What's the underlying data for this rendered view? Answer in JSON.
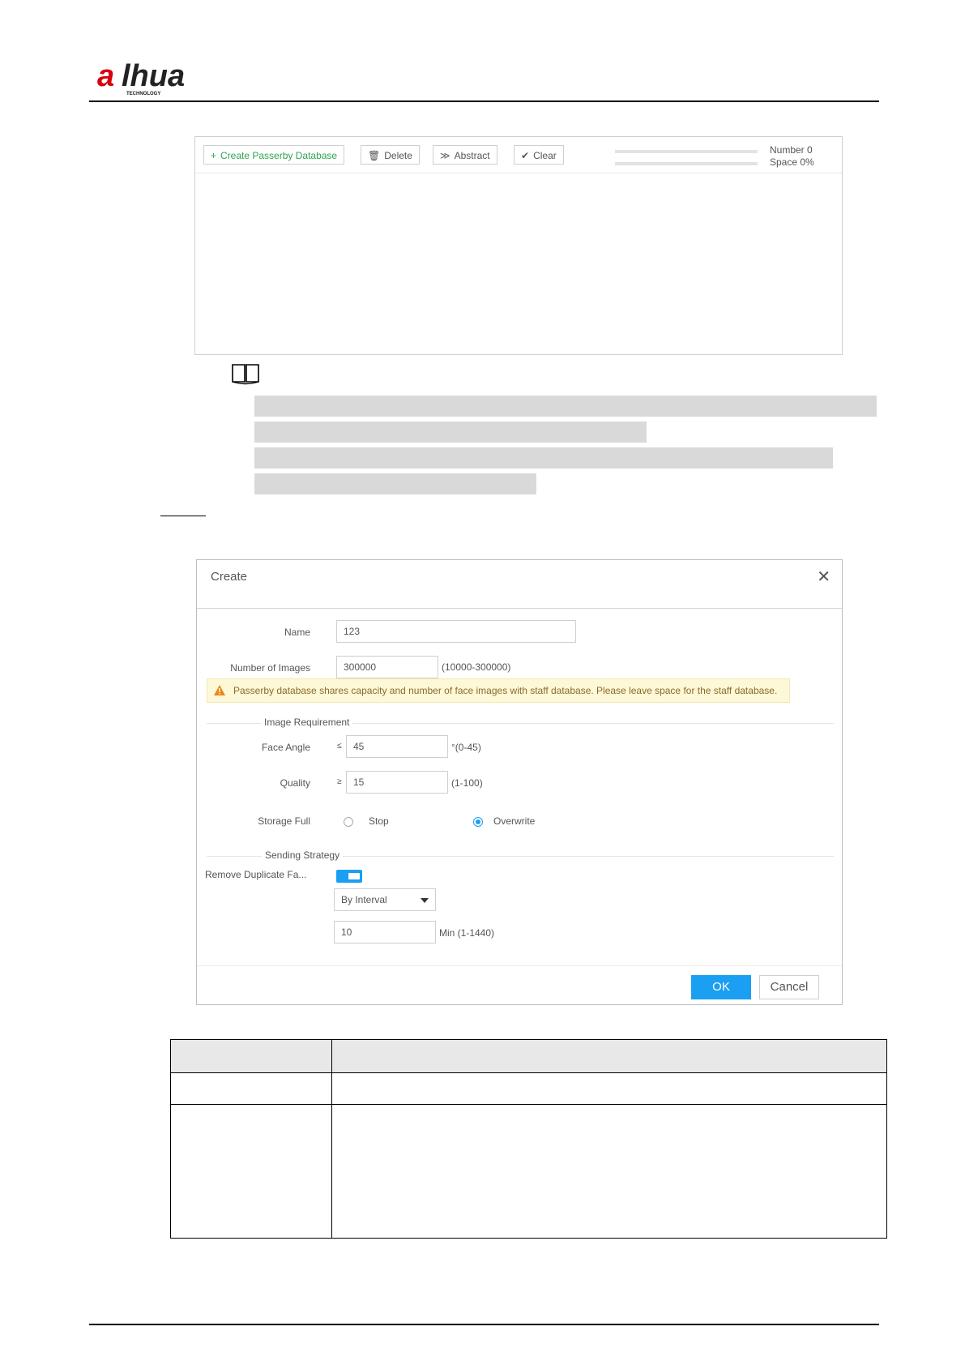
{
  "header": {
    "logo_text": "alhua",
    "logo_subtext": "TECHNOLOGY"
  },
  "database_toolbar": {
    "create_label": "Create Passerby Database",
    "delete_label": "Delete",
    "abstract_label": "Abstract",
    "clear_label": "Clear",
    "number_label": "Number 0",
    "space_label": "Space 0%"
  },
  "create_dialog": {
    "title": "Create",
    "name_label": "Name",
    "name_value": "123",
    "images_label": "Number of Images",
    "images_value": "300000",
    "images_range": "(10000-300000)",
    "warning": "Passerby database shares capacity and number of face images with staff database. Please leave space for the staff database.",
    "image_req_section": "Image Requirement",
    "face_angle_label": "Face Angle",
    "face_angle_op": "≤",
    "face_angle_value": "45",
    "face_angle_range": "°(0-45)",
    "quality_label": "Quality",
    "quality_op": "≥",
    "quality_value": "15",
    "quality_range": "(1-100)",
    "storage_full_label": "Storage Full",
    "stop_label": "Stop",
    "overwrite_label": "Overwrite",
    "sending_section": "Sending Strategy",
    "remove_dup_label": "Remove Duplicate Fa...",
    "mode_value": "By Interval",
    "interval_value": "10",
    "interval_range": "Min (1-1440)",
    "ok_label": "OK",
    "cancel_label": "Cancel"
  }
}
